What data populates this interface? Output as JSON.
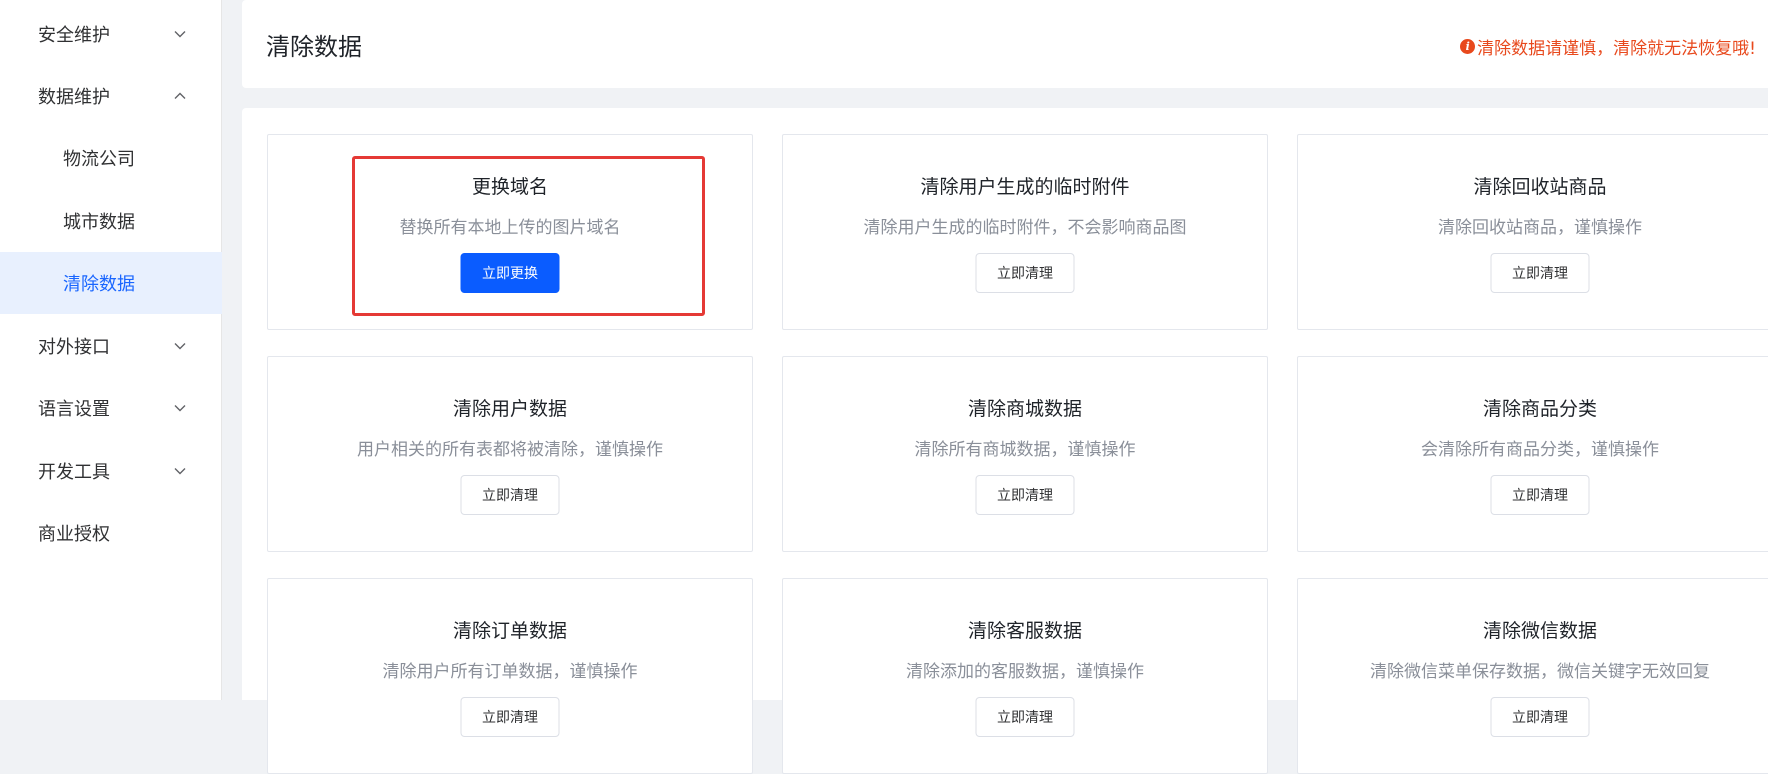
{
  "sidebar": {
    "items": [
      {
        "label": "安全维护",
        "level": 1,
        "chevron": "down"
      },
      {
        "label": "数据维护",
        "level": 1,
        "chevron": "up"
      },
      {
        "label": "物流公司",
        "level": 2
      },
      {
        "label": "城市数据",
        "level": 2
      },
      {
        "label": "清除数据",
        "level": 2,
        "active": true
      },
      {
        "label": "对外接口",
        "level": 1,
        "chevron": "down"
      },
      {
        "label": "语言设置",
        "level": 1,
        "chevron": "down"
      },
      {
        "label": "开发工具",
        "level": 1,
        "chevron": "down"
      },
      {
        "label": "商业授权",
        "level": 1
      }
    ]
  },
  "header": {
    "title": "清除数据",
    "warning_icon": "info-icon",
    "warning": "清除数据请谨慎，清除就无法恢复哦!"
  },
  "cards": [
    {
      "title": "更换域名",
      "desc": "替换所有本地上传的图片域名",
      "button": "立即更换",
      "primary": true,
      "highlighted": true
    },
    {
      "title": "清除用户生成的临时附件",
      "desc": "清除用户生成的临时附件，不会影响商品图",
      "button": "立即清理"
    },
    {
      "title": "清除回收站商品",
      "desc": "清除回收站商品，谨慎操作",
      "button": "立即清理"
    },
    {
      "title": "清除用户数据",
      "desc": "用户相关的所有表都将被清除，谨慎操作",
      "button": "立即清理"
    },
    {
      "title": "清除商城数据",
      "desc": "清除所有商城数据，谨慎操作",
      "button": "立即清理"
    },
    {
      "title": "清除商品分类",
      "desc": "会清除所有商品分类，谨慎操作",
      "button": "立即清理"
    },
    {
      "title": "清除订单数据",
      "desc": "清除用户所有订单数据，谨慎操作",
      "button": "立即清理"
    },
    {
      "title": "清除客服数据",
      "desc": "清除添加的客服数据，谨慎操作",
      "button": "立即清理"
    },
    {
      "title": "清除微信数据",
      "desc": "清除微信菜单保存数据，微信关键字无效回复",
      "button": "立即清理"
    }
  ],
  "colors": {
    "accent": "#0a5cff",
    "active_text": "#1a66ff",
    "active_bg": "#e8f0fe",
    "warning": "#e8491d",
    "highlight_border": "#e53935"
  }
}
